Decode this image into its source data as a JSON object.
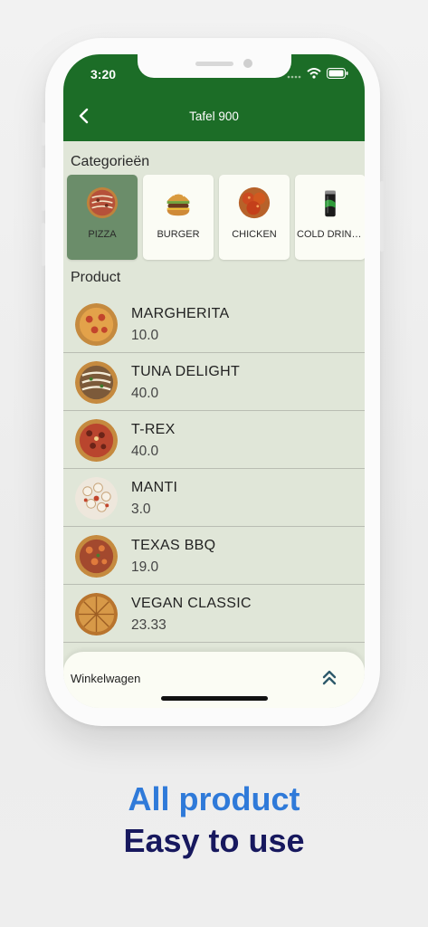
{
  "status_bar": {
    "time": "3:20"
  },
  "header": {
    "title": "Tafel 900"
  },
  "categories": {
    "heading": "Categorieën",
    "items": [
      {
        "label": "PIZZA",
        "icon": "pizza-icon",
        "selected": true
      },
      {
        "label": "BURGER",
        "icon": "burger-icon",
        "selected": false
      },
      {
        "label": "CHICKEN",
        "icon": "chicken-icon",
        "selected": false
      },
      {
        "label": "COLD DRINKS",
        "icon": "cold-drink-icon",
        "selected": false
      }
    ]
  },
  "products": {
    "heading": "Product",
    "items": [
      {
        "name": "MARGHERITA",
        "price": "10.0"
      },
      {
        "name": "TUNA DELIGHT",
        "price": "40.0"
      },
      {
        "name": "T-REX",
        "price": "40.0"
      },
      {
        "name": "MANTI",
        "price": "3.0"
      },
      {
        "name": "TEXAS BBQ",
        "price": "19.0"
      },
      {
        "name": "VEGAN CLASSIC",
        "price": "23.33"
      }
    ]
  },
  "cart": {
    "label": "Winkelwagen"
  },
  "promo": {
    "line1": "All product",
    "line2": "Easy to use"
  },
  "colors": {
    "header": "#1c6d27",
    "accent": "#2f7ad9",
    "navy": "#17185e"
  }
}
